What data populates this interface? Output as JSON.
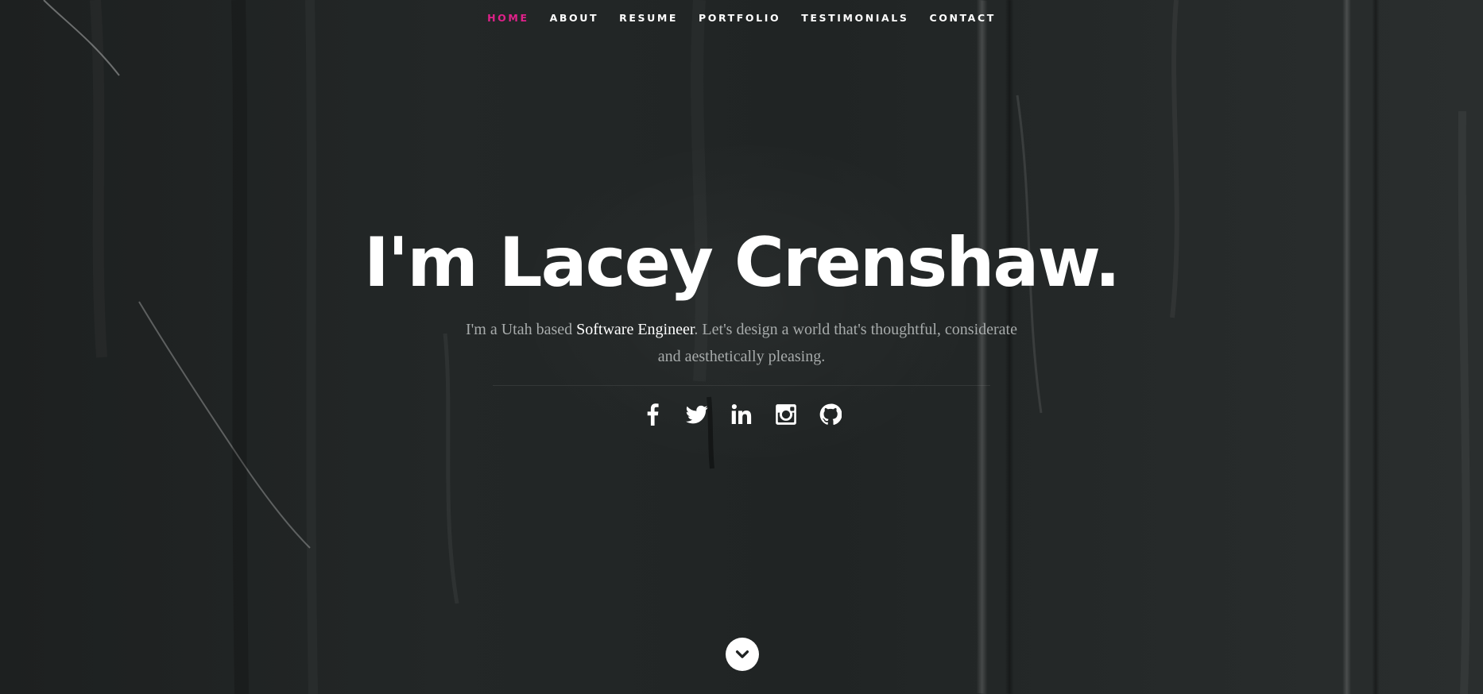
{
  "nav": {
    "items": [
      {
        "label": "HOME",
        "active": true
      },
      {
        "label": "ABOUT",
        "active": false
      },
      {
        "label": "RESUME",
        "active": false
      },
      {
        "label": "PORTFOLIO",
        "active": false
      },
      {
        "label": "TESTIMONIALS",
        "active": false
      },
      {
        "label": "CONTACT",
        "active": false
      }
    ],
    "active_color": "#e0218a"
  },
  "hero": {
    "headline": "I'm Lacey Crenshaw.",
    "intro_before": "I'm a Utah based ",
    "intro_highlight": "Software Engineer",
    "intro_after": ". Let's design a world that's thoughtful, considerate and aesthetically pleasing.",
    "background_color": "#232727"
  },
  "social": {
    "icons": [
      "facebook-icon",
      "twitter-icon",
      "linkedin-icon",
      "instagram-icon",
      "github-icon"
    ]
  },
  "scroll_button": {
    "icon": "chevron-down-icon"
  }
}
